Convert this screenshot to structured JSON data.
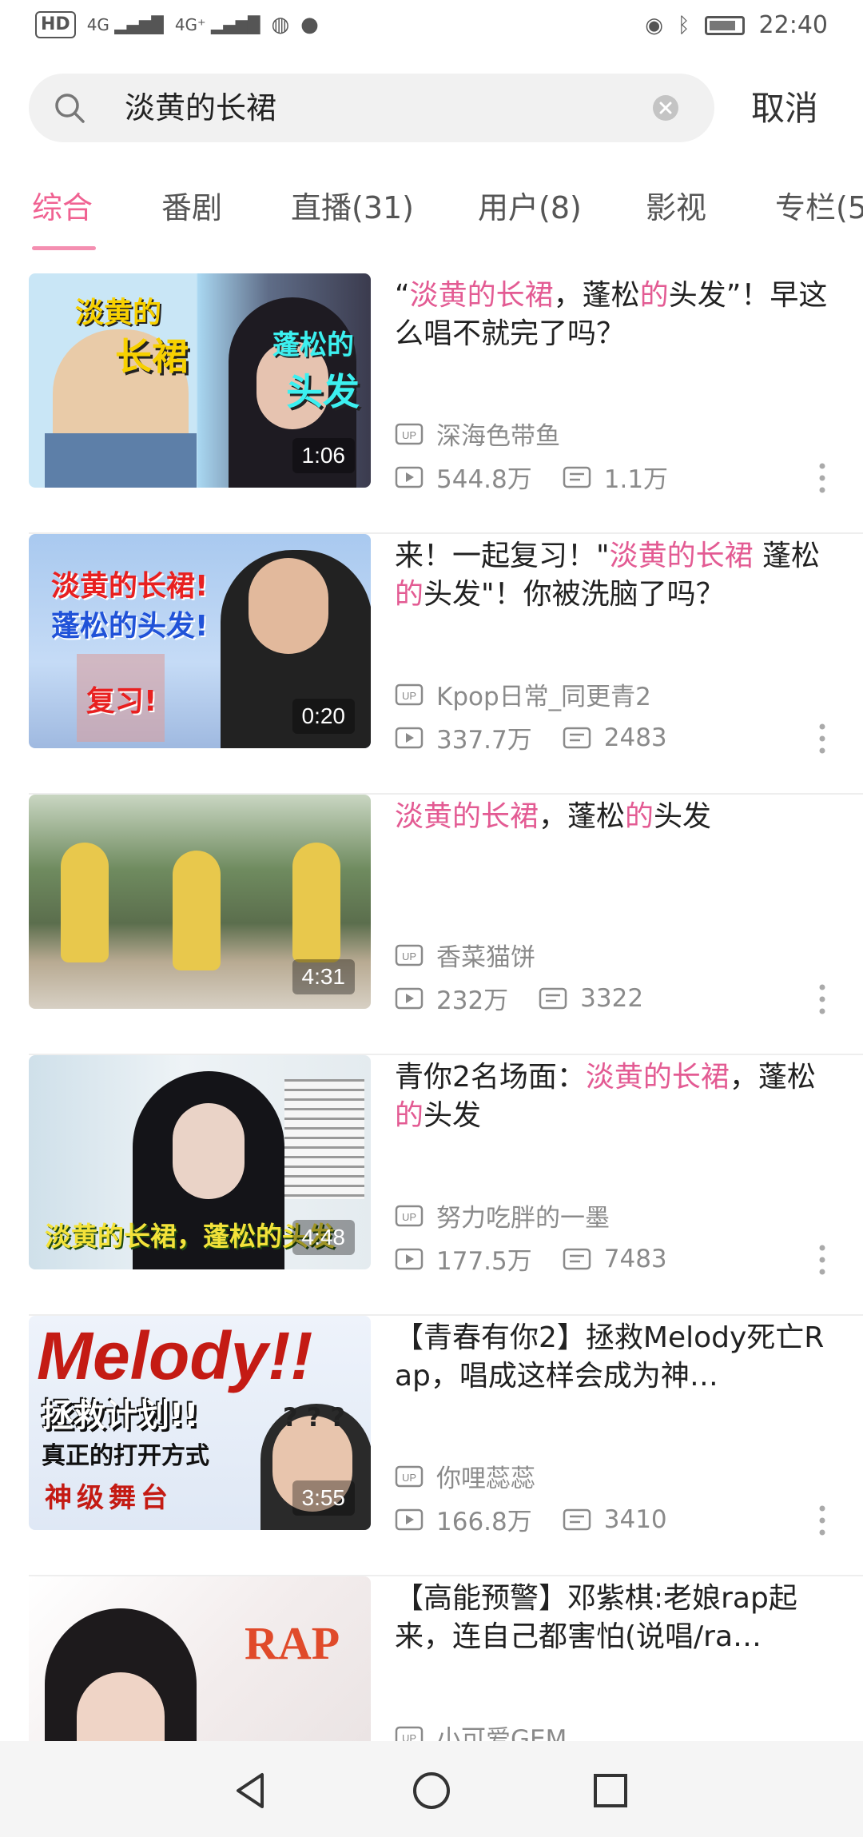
{
  "status": {
    "network_left": "HD",
    "net1": "4G",
    "net2": "4G⁺",
    "time": "22:40"
  },
  "search": {
    "query": "淡黄的长裙",
    "cancel_label": "取消"
  },
  "tabs": [
    "综合",
    "番剧",
    "直播(31)",
    "用户(8)",
    "影视",
    "专栏(5"
  ],
  "colors": {
    "accent": "#f06292",
    "highlight": "#e35b93",
    "meta": "#8a8a8a"
  },
  "results": [
    {
      "title_parts": [
        "“",
        "淡黄的长裙",
        "，蓬松",
        "的",
        "头发”！早这么唱不就完了吗？"
      ],
      "uploader": "深海色带鱼",
      "views": "544.8万",
      "danmaku": "1.1万",
      "duration": "1:06",
      "overlay": [
        "淡黄的",
        "长裙",
        "蓬松的",
        "头发"
      ]
    },
    {
      "title_parts": [
        "来！一起复习！\"",
        "淡黄的长裙",
        " 蓬松",
        "的",
        "头发\"！你被洗脑了吗？"
      ],
      "uploader": "Kpop日常_同更青2",
      "views": "337.7万",
      "danmaku": "2483",
      "duration": "0:20",
      "overlay": [
        "淡黄的长裙!",
        "蓬松的头发!",
        "复习!"
      ]
    },
    {
      "title_parts": [
        "",
        "淡黄的长裙",
        "，蓬松",
        "的",
        "头发"
      ],
      "uploader": "香菜猫饼",
      "views": "232万",
      "danmaku": "3322",
      "duration": "4:31",
      "overlay": []
    },
    {
      "title_parts": [
        "青你2名场面：",
        "淡黄的长裙",
        "，蓬松",
        "的",
        "头发"
      ],
      "uploader": "努力吃胖的一墨",
      "views": "177.5万",
      "danmaku": "7483",
      "duration": "4:48",
      "overlay": [
        "淡黄的长裙，蓬松的头发"
      ]
    },
    {
      "title_parts": [
        "【青春有你2】拯救Melody死亡Rap，唱成这样会成为神…",
        "",
        "",
        "",
        ""
      ],
      "uploader": "你哩蕊蕊",
      "views": "166.8万",
      "danmaku": "3410",
      "duration": "3:55",
      "overlay": [
        "Melody!!",
        "拯救计划!!",
        "真正的打开方式",
        "神级舞台",
        "? ? ?"
      ]
    },
    {
      "title_parts": [
        "【高能预警】邓紫棋:老娘rap起来，连自己都害怕(说唱/ra…",
        "",
        "",
        "",
        ""
      ],
      "uploader": "小可爱GEM",
      "views": "",
      "danmaku": "",
      "duration": "",
      "overlay": [
        "RAP"
      ]
    }
  ]
}
